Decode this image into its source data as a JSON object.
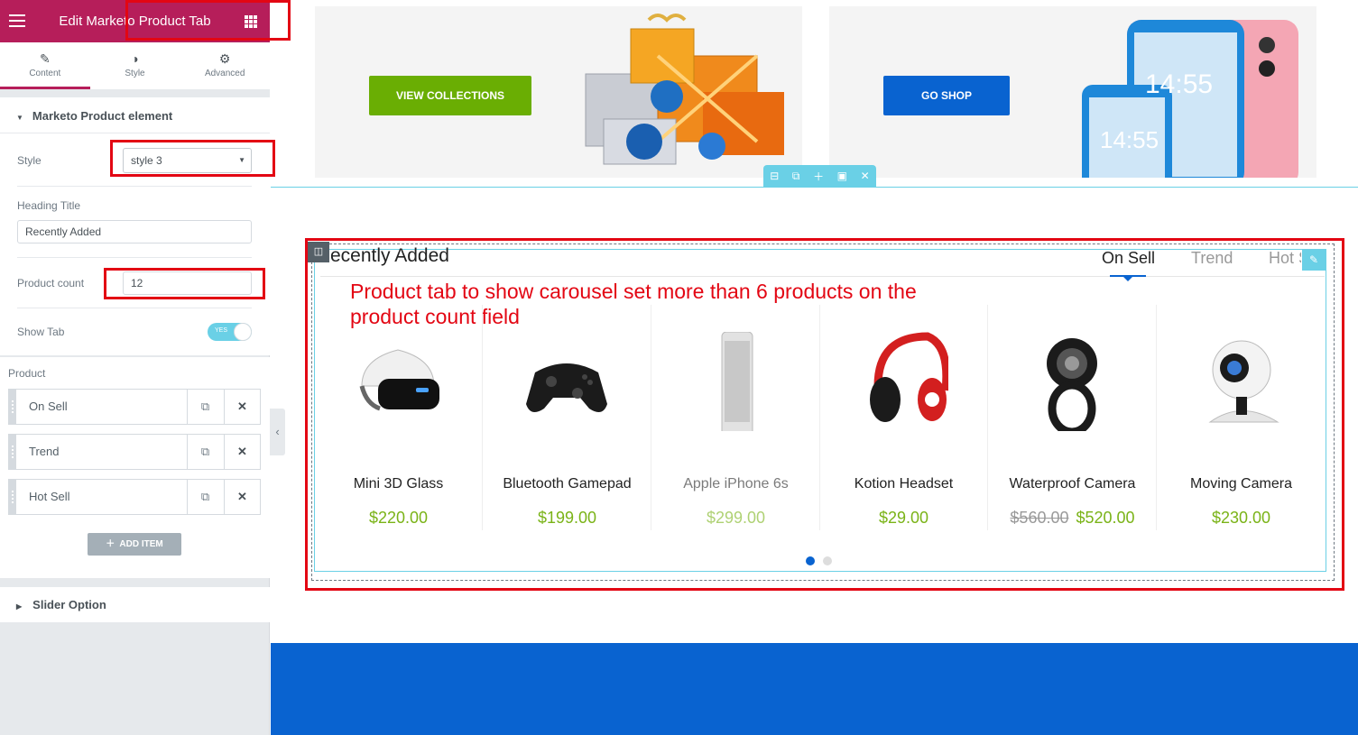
{
  "panel": {
    "title": "Edit Marketo Product Tab",
    "tabs": [
      {
        "label": "Content",
        "icon": "pencil-icon"
      },
      {
        "label": "Style",
        "icon": "contrast-icon"
      },
      {
        "label": "Advanced",
        "icon": "gear-icon"
      }
    ],
    "section_title": "Marketo Product element",
    "style_label": "Style",
    "style_value": "style 3",
    "heading_title_label": "Heading Title",
    "heading_title_value": "Recently Added",
    "product_count_label": "Product count",
    "product_count_value": "12",
    "show_tab_label": "Show Tab",
    "show_tab_toggle": "YES",
    "product_label": "Product",
    "repeater_items": [
      "On Sell",
      "Trend",
      "Hot Sell"
    ],
    "add_item_label": "ADD ITEM",
    "slider_option_label": "Slider Option"
  },
  "preview": {
    "banner1_button": "VIEW COLLECTIONS",
    "banner2_button": "GO SHOP",
    "phone_time_1": "14:55",
    "phone_time_2": "14:55",
    "heading": "ecently Added",
    "tabs": [
      "On Sell",
      "Trend",
      "Hot S"
    ],
    "annotation": "Product tab to show carousel set more than 6 products on the product count field",
    "products": [
      {
        "name": "Mini 3D Glass",
        "price": "$220.00",
        "old_price": ""
      },
      {
        "name": "Bluetooth Gamepad",
        "price": "$199.00",
        "old_price": ""
      },
      {
        "name": "Apple iPhone 6s",
        "price": "$299.00",
        "old_price": ""
      },
      {
        "name": "Kotion Headset",
        "price": "$29.00",
        "old_price": ""
      },
      {
        "name": "Waterproof Camera",
        "price": "$520.00",
        "old_price": "$560.00"
      },
      {
        "name": "Moving Camera",
        "price": "$230.00",
        "old_price": ""
      }
    ]
  },
  "colors": {
    "editor_brand": "#b61e5a",
    "annotation_red": "#e30613",
    "accent_blue": "#0963d0",
    "price_green": "#7ab317",
    "view_button_green": "#6aae03",
    "editor_cyan": "#6ad0e6"
  }
}
